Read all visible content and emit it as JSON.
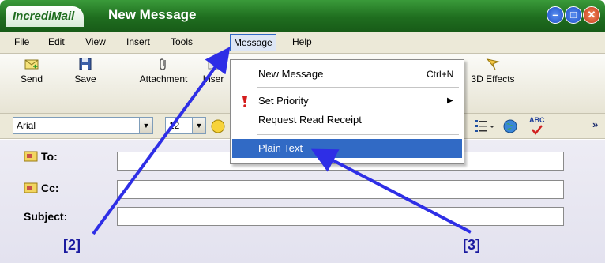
{
  "window": {
    "app_name": "IncrediMail",
    "title": "New Message",
    "min_symbol": "–",
    "max_symbol": "□",
    "close_symbol": "✕"
  },
  "menubar": {
    "file": "File",
    "edit": "Edit",
    "view": "View",
    "insert": "Insert",
    "tools": "Tools",
    "message": "Message",
    "help": "Help"
  },
  "toolbar": {
    "send": "Send",
    "save": "Save",
    "attachment": "Attachment",
    "insert": "Inser",
    "effects3d": "3D Effects"
  },
  "format": {
    "font": "Arial",
    "size": "12",
    "spell": "ABC",
    "more": "»"
  },
  "headers": {
    "to": "To:",
    "cc": "Cc:",
    "subject": "Subject:",
    "to_value": "",
    "cc_value": "",
    "subject_value": ""
  },
  "dropdown": {
    "new_message": "New Message",
    "new_message_shortcut": "Ctrl+N",
    "set_priority": "Set Priority",
    "request_receipt": "Request Read Receipt",
    "plain_text": "Plain Text"
  },
  "annotations": {
    "a2": "[2]",
    "a3": "[3]"
  },
  "colors": {
    "title_green": "#1f6e1f",
    "highlight_blue": "#316ac5",
    "arrow_blue": "#2e2ee6"
  }
}
